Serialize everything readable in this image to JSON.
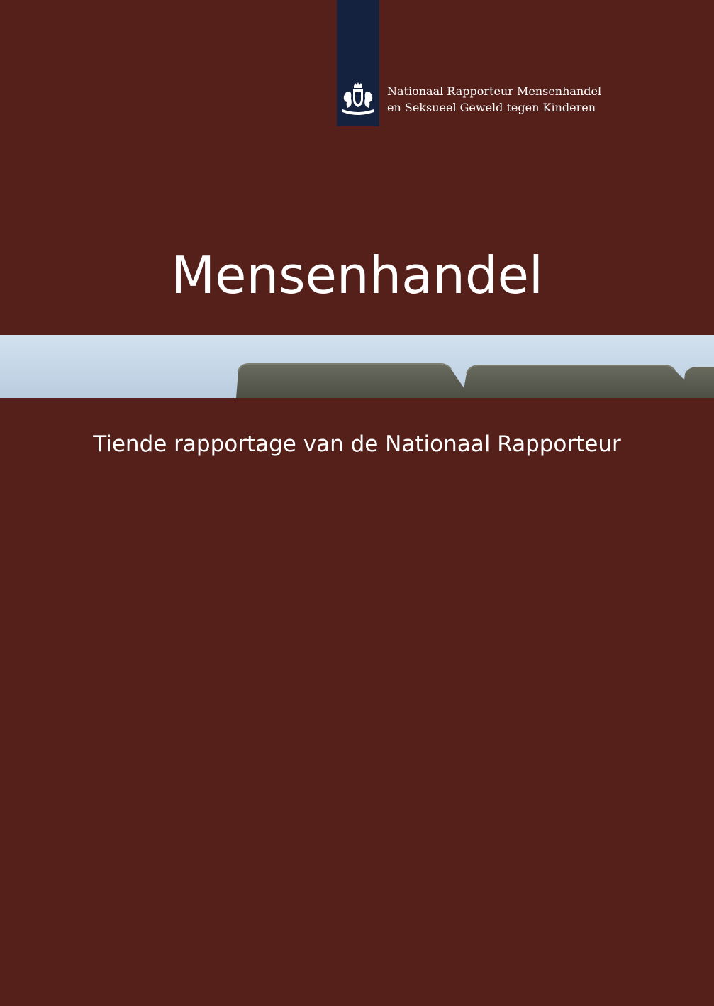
{
  "colors": {
    "background": "#55201a",
    "logo_strip": "#15223f",
    "text": "#ffffff",
    "sky": "#c4d6e6",
    "roof": "#5b5d51"
  },
  "logo": {
    "icon": "dutch-royal-coat-of-arms-icon"
  },
  "organisation": {
    "line1": "Nationaal Rapporteur Mensenhandel",
    "line2": "en Seksueel Geweld tegen Kinderen"
  },
  "cover": {
    "title": "Mensenhandel",
    "subtitle": "Tiende rapportage van de Nationaal Rapporteur"
  },
  "photo": {
    "description_icon": "rooftop-photo"
  }
}
